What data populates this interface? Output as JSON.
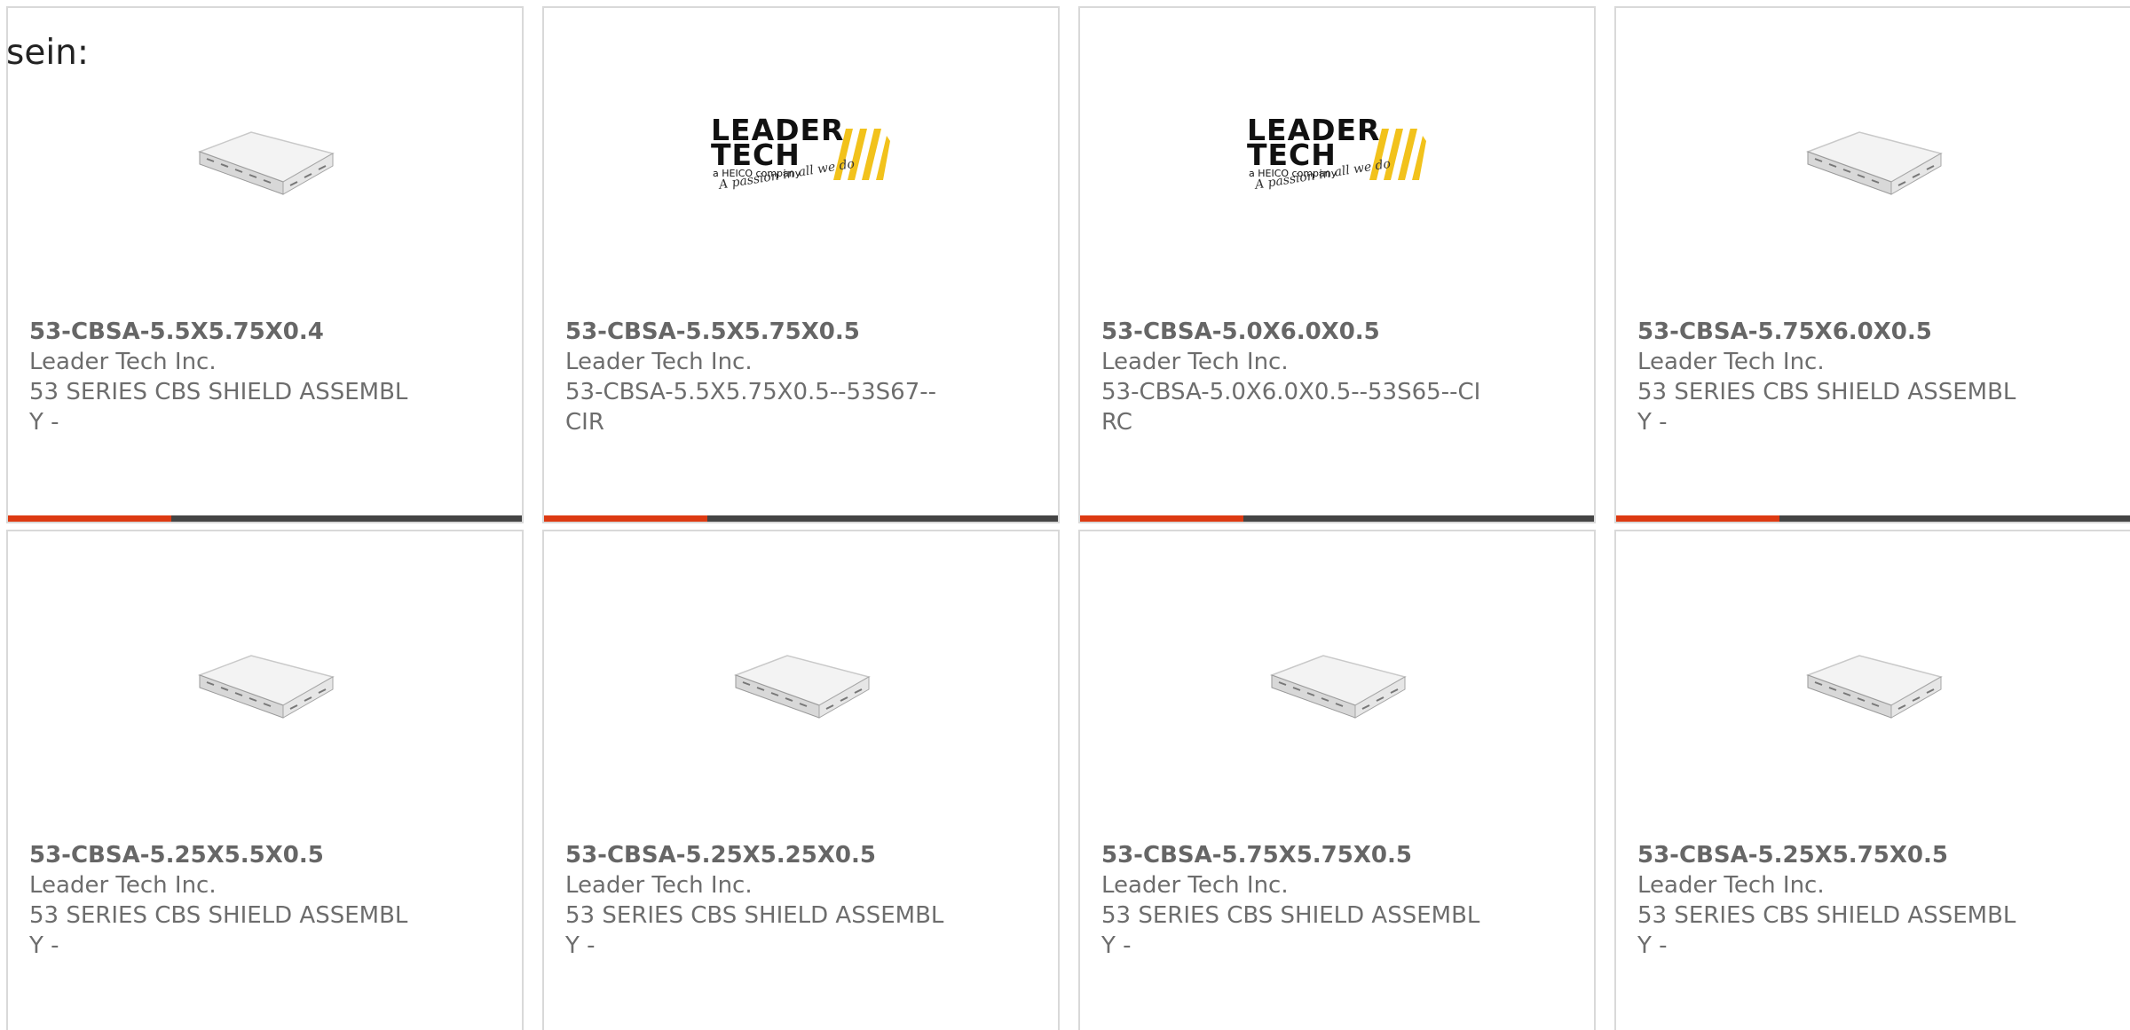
{
  "intro_text": "sein:",
  "colors": {
    "accent": "#dd3a12",
    "bar": "#444444",
    "border": "#d9d9d9",
    "text": "#6d6d6d",
    "logo_yellow": "#f2c21b"
  },
  "logo": {
    "line1": "LEADER",
    "line2": "TECH",
    "company": "a HEICO company",
    "tagline": "A passion in all we do"
  },
  "products": [
    {
      "part_number": "53-CBSA-5.5X5.75X0.4",
      "manufacturer": "Leader Tech Inc.",
      "description": "53 SERIES CBS SHIELD ASSEMBLY -",
      "image": "shield-image"
    },
    {
      "part_number": "53-CBSA-5.5X5.75X0.5",
      "manufacturer": "Leader Tech Inc.",
      "description": "53-CBSA-5.5X5.75X0.5--53S67--CIR",
      "image": "leader-tech-logo"
    },
    {
      "part_number": "53-CBSA-5.0X6.0X0.5",
      "manufacturer": "Leader Tech Inc.",
      "description": "53-CBSA-5.0X6.0X0.5--53S65--CIRC",
      "image": "leader-tech-logo"
    },
    {
      "part_number": "53-CBSA-5.75X6.0X0.5",
      "manufacturer": "Leader Tech Inc.",
      "description": "53 SERIES CBS SHIELD ASSEMBLY -",
      "image": "shield-image"
    },
    {
      "part_number": "53-CBSA-5.25X5.5X0.5",
      "manufacturer": "Leader Tech Inc.",
      "description": "53 SERIES CBS SHIELD ASSEMBLY -",
      "image": "shield-image"
    },
    {
      "part_number": "53-CBSA-5.25X5.25X0.5",
      "manufacturer": "Leader Tech Inc.",
      "description": "53 SERIES CBS SHIELD ASSEMBLY -",
      "image": "shield-image"
    },
    {
      "part_number": "53-CBSA-5.75X5.75X0.5",
      "manufacturer": "Leader Tech Inc.",
      "description": "53 SERIES CBS SHIELD ASSEMBLY -",
      "image": "shield-image"
    },
    {
      "part_number": "53-CBSA-5.25X5.75X0.5",
      "manufacturer": "Leader Tech Inc.",
      "description": "53 SERIES CBS SHIELD ASSEMBLY -",
      "image": "shield-image"
    }
  ]
}
